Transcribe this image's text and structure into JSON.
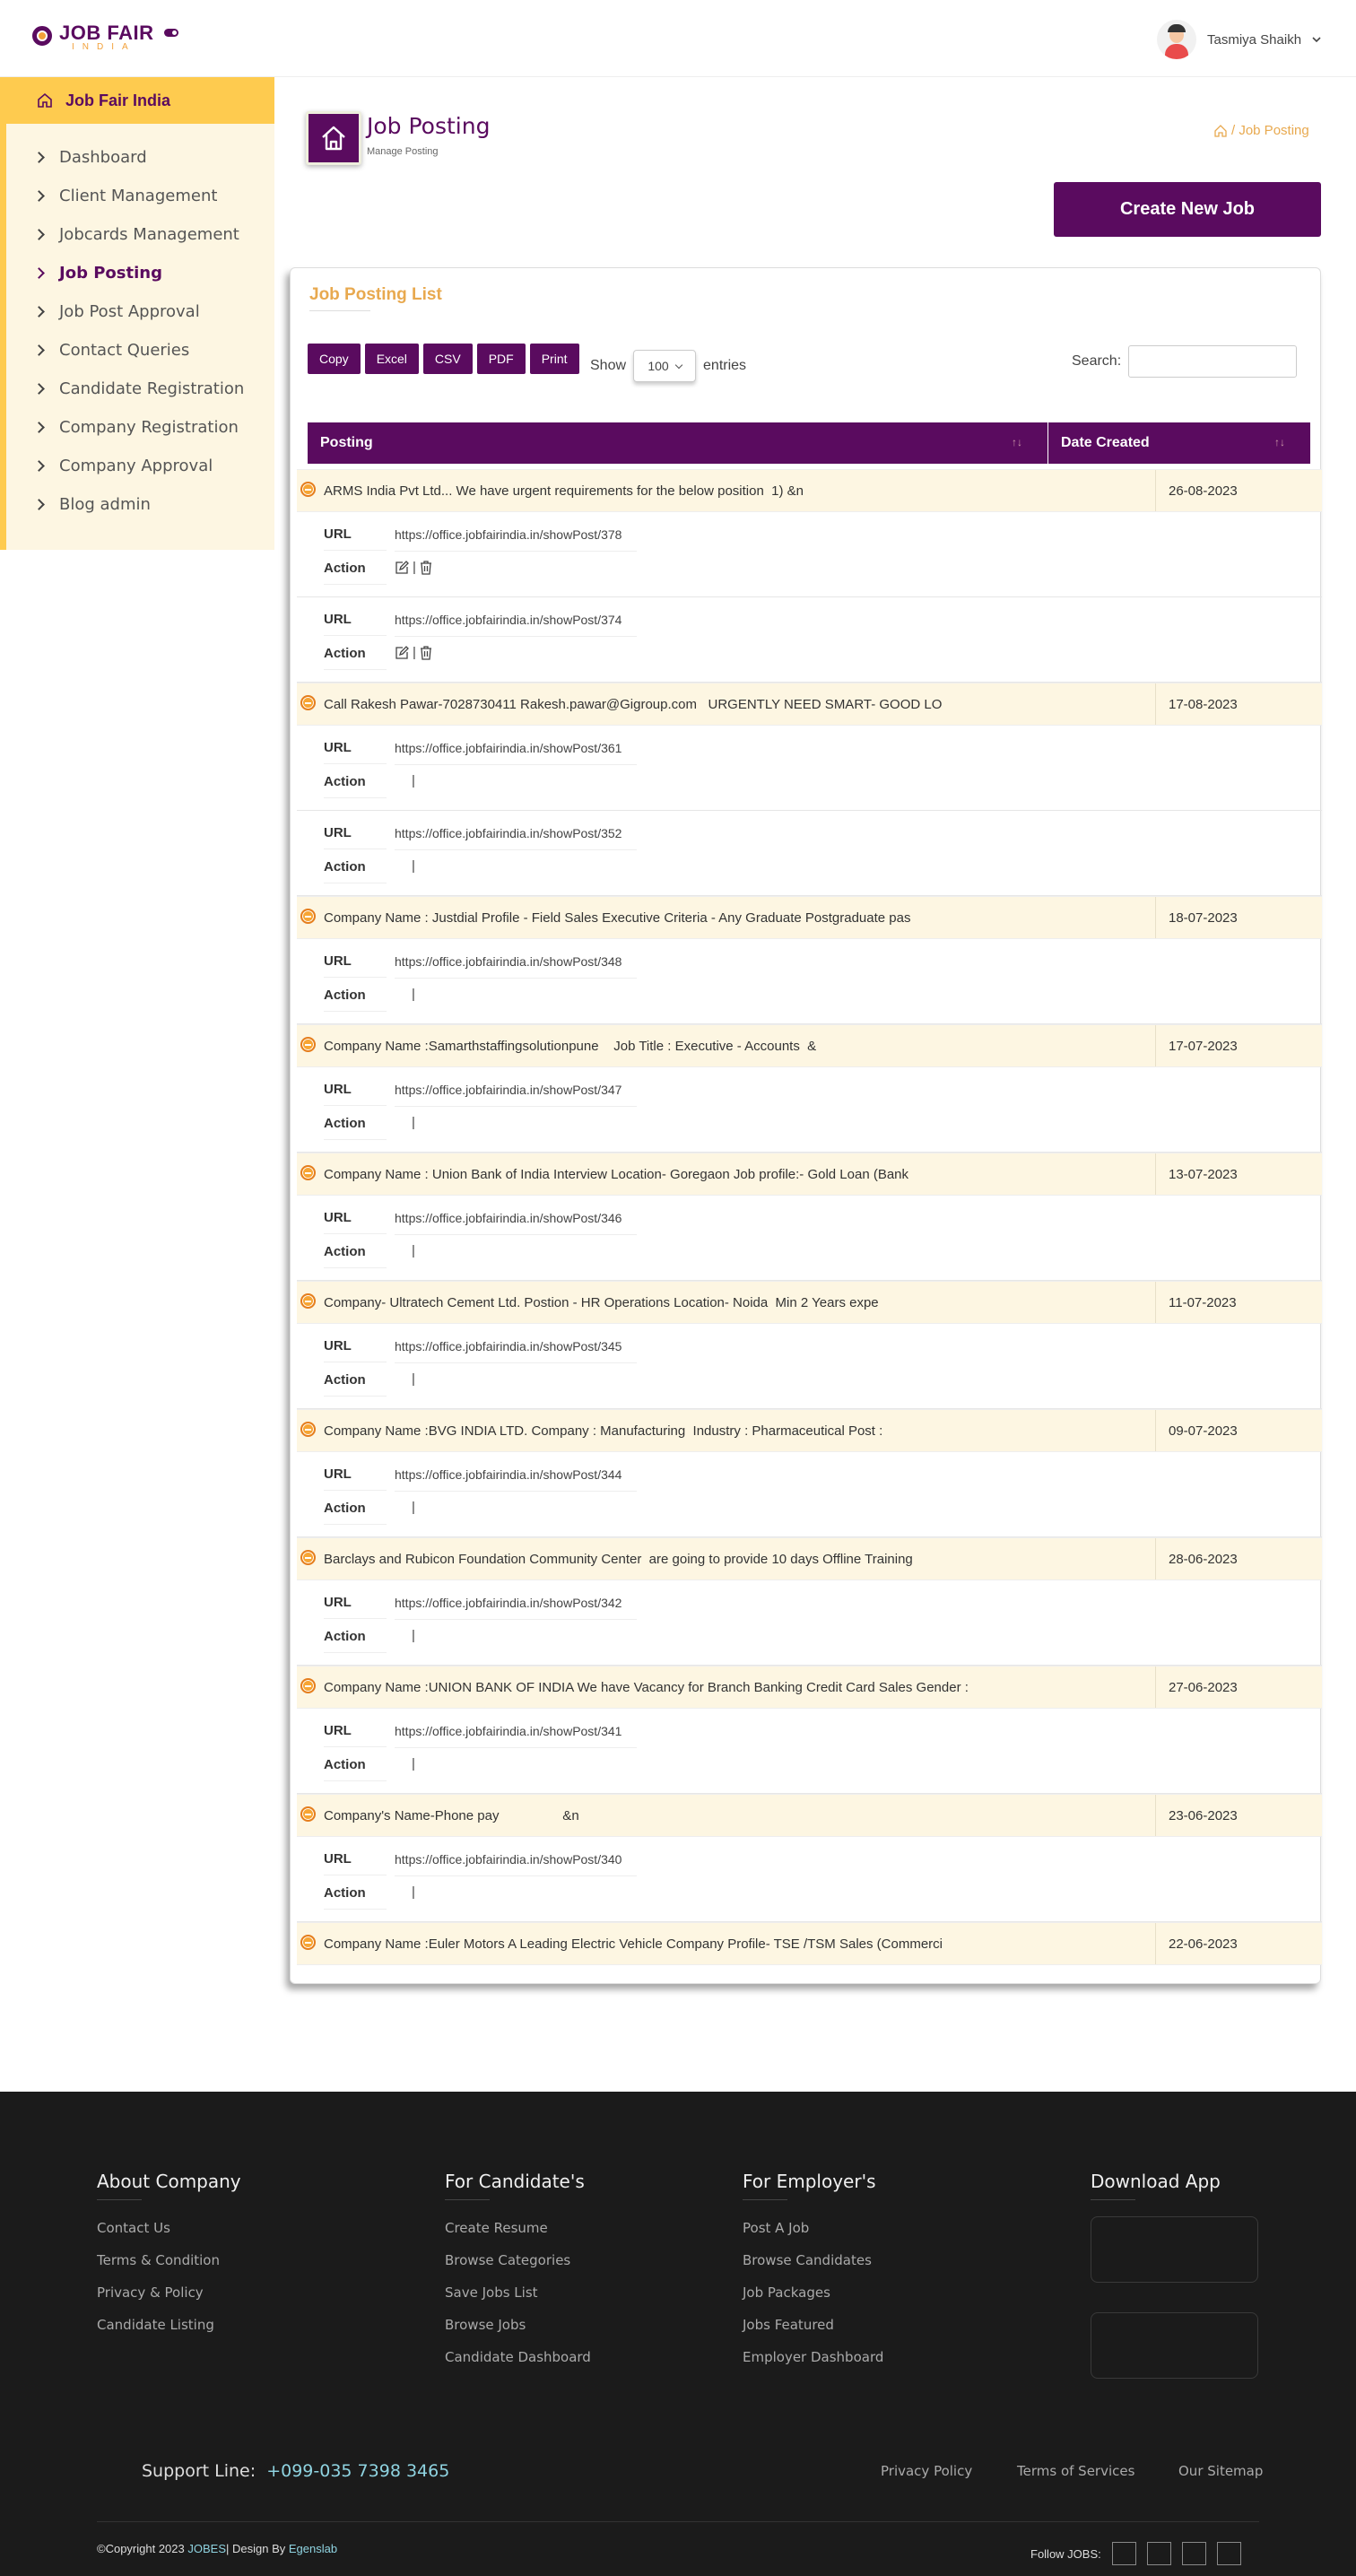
{
  "header": {
    "logo_line1": "JOB FAIR",
    "logo_line2": "INDIA",
    "user_name": "Tasmiya Shaikh"
  },
  "sidebar": {
    "title": "Job Fair India",
    "items": [
      {
        "label": "Dashboard"
      },
      {
        "label": "Client Management"
      },
      {
        "label": "Jobcards Management"
      },
      {
        "label": "Job Posting",
        "active": true
      },
      {
        "label": "Job Post Approval"
      },
      {
        "label": " Contact Queries"
      },
      {
        "label": "Candidate Registration"
      },
      {
        "label": "Company Registration"
      },
      {
        "label": "Company Approval"
      },
      {
        "label": "Blog admin"
      }
    ]
  },
  "page": {
    "title": "Job Posting",
    "subtitle": "Manage Posting",
    "breadcrumb": "/ Job Posting",
    "create_button": "Create New Job"
  },
  "card": {
    "title": "Job Posting List",
    "buttons": [
      "Copy",
      "Excel",
      "CSV",
      "PDF",
      "Print"
    ],
    "show_label": "Show",
    "entries_value": "100",
    "entries_label": "entries",
    "search_label": "Search:",
    "columns": [
      "Posting",
      "Date Created"
    ],
    "url_label": "URL",
    "action_label": "Action"
  },
  "rows": [
    {
      "posting": "ARMS India Pvt Ltd... We have urgent requirements for the below position  1) &n",
      "date": "26-08-2023",
      "children": [
        {
          "url": "https://office.jobfairindia.in/showPost/378",
          "icons": true
        },
        {
          "url": "https://office.jobfairindia.in/showPost/374",
          "icons": true
        }
      ]
    },
    {
      "posting": "Call Rakesh Pawar-7028730411 Rakesh.pawar@Gigroup.com   URGENTLY NEED SMART- GOOD LO",
      "date": "17-08-2023",
      "children": [
        {
          "url": "https://office.jobfairindia.in/showPost/361",
          "icons": false
        },
        {
          "url": "https://office.jobfairindia.in/showPost/352",
          "icons": false
        }
      ]
    },
    {
      "posting": "Company Name : Justdial Profile - Field Sales Executive Criteria - Any Graduate Postgraduate pas",
      "date": "18-07-2023",
      "children": [
        {
          "url": "https://office.jobfairindia.in/showPost/348",
          "icons": false
        }
      ]
    },
    {
      "posting": "Company Name :Samarthstaffingsolutionpune    Job Title : Executive - Accounts  &",
      "date": "17-07-2023",
      "children": [
        {
          "url": "https://office.jobfairindia.in/showPost/347",
          "icons": false
        }
      ]
    },
    {
      "posting": "Company Name : Union Bank of India Interview Location- Goregaon Job profile:- Gold Loan (Bank",
      "date": "13-07-2023",
      "children": [
        {
          "url": "https://office.jobfairindia.in/showPost/346",
          "icons": false
        }
      ]
    },
    {
      "posting": "Company- Ultratech Cement Ltd. Postion - HR Operations Location- Noida  Min 2 Years expe",
      "date": "11-07-2023",
      "children": [
        {
          "url": "https://office.jobfairindia.in/showPost/345",
          "icons": false
        }
      ]
    },
    {
      "posting": "Company Name :BVG INDIA LTD. Company : Manufacturing  Industry : Pharmaceutical Post :",
      "date": "09-07-2023",
      "children": [
        {
          "url": "https://office.jobfairindia.in/showPost/344",
          "icons": false
        }
      ]
    },
    {
      "posting": "Barclays and Rubicon Foundation Community Center  are going to provide 10 days Offline Training",
      "date": "28-06-2023",
      "children": [
        {
          "url": "https://office.jobfairindia.in/showPost/342",
          "icons": false
        }
      ]
    },
    {
      "posting": "Company Name :UNION BANK OF INDIA We have Vacancy for Branch Banking Credit Card Sales Gender :",
      "date": "27-06-2023",
      "children": [
        {
          "url": "https://office.jobfairindia.in/showPost/341",
          "icons": false
        }
      ]
    },
    {
      "posting": "Company's Name-Phone pay                 &n",
      "date": "23-06-2023",
      "children": [
        {
          "url": "https://office.jobfairindia.in/showPost/340",
          "icons": false
        }
      ]
    },
    {
      "posting": "Company Name :Euler Motors A Leading Electric Vehicle Company Profile- TSE /TSM Sales (Commerci",
      "date": "22-06-2023",
      "children": []
    }
  ],
  "footer": {
    "columns": [
      {
        "title": "About Company",
        "links": [
          "Contact Us",
          "Terms & Condition",
          "Privacy & Policy",
          "Candidate Listing"
        ]
      },
      {
        "title": "For Candidate's",
        "links": [
          "Create Resume",
          "Browse Categories",
          "Save Jobs List",
          "Browse Jobs",
          "Candidate Dashboard"
        ]
      },
      {
        "title": "For Employer's",
        "links": [
          "Post A Job",
          "Browse Candidates",
          "Job Packages",
          "Jobs Featured",
          "Employer Dashboard"
        ]
      },
      {
        "title": "Download App",
        "links": []
      }
    ],
    "support_label": "Support Line:",
    "support_phone": "+099-035 7398 3465",
    "bottom_links": [
      "Privacy Policy",
      "Terms of Services",
      "Our Sitemap"
    ],
    "copyright_prefix": "©Copyright 2023",
    "copyright_brand": "JOBES",
    "copyright_mid": "| Design By",
    "copyright_designer": "Egenslab",
    "follow_label": "Follow JOBS:"
  }
}
